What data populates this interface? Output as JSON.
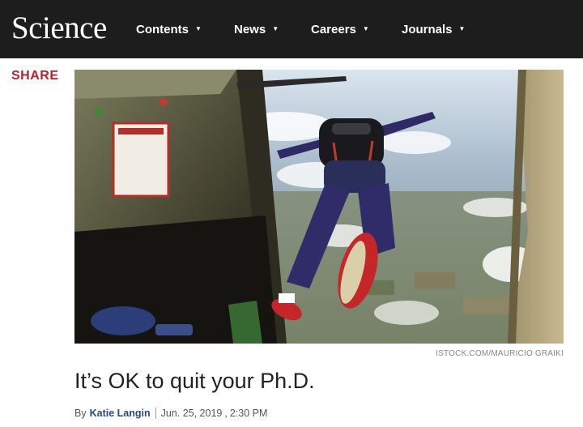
{
  "header": {
    "logo": "Science",
    "nav": [
      {
        "label": "Contents"
      },
      {
        "label": "News"
      },
      {
        "label": "Careers"
      },
      {
        "label": "Journals"
      }
    ],
    "colors": {
      "bar": "#1d1d1d",
      "text": "#ffffff"
    }
  },
  "share": {
    "label": "SHARE",
    "color": "#b1242a"
  },
  "image": {
    "description_icon": "skydiver-photo",
    "credit": "ISTOCK.COM/MAURICIO GRAIKI"
  },
  "article": {
    "title": "It’s OK to quit your Ph.D.",
    "byline_prefix": "By",
    "author": "Katie Langin",
    "date": "Jun. 25, 2019",
    "time": "2:30 PM"
  }
}
